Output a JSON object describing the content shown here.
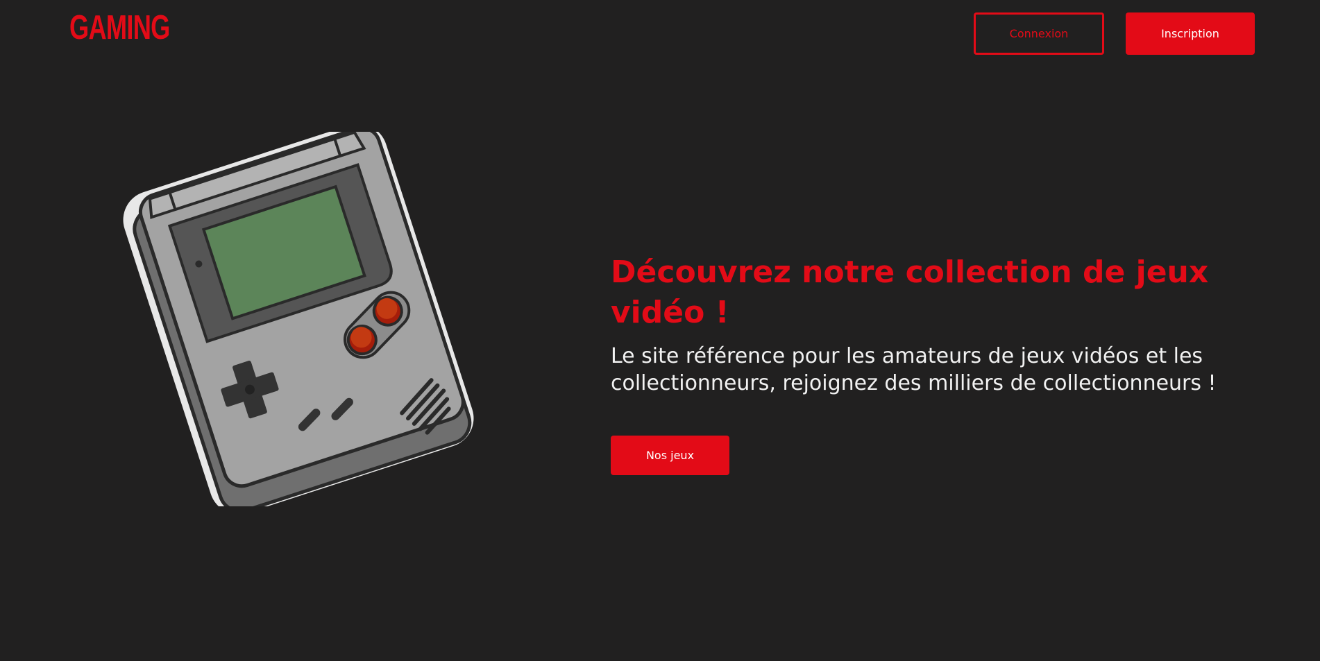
{
  "header": {
    "logo_text": "GAMING",
    "login_label": "Connexion",
    "signup_label": "Inscription"
  },
  "hero": {
    "title": "Découvrez notre collection de jeux vidéo !",
    "subtitle": "Le site référence pour les amateurs de jeux vidéos et les collectionneurs, rejoignez des milliers de collectionneurs !",
    "cta_label": "Nos jeux",
    "illustration": "handheld-console-icon"
  },
  "colors": {
    "background": "#212020",
    "accent": "#e30b17",
    "text": "#f2f2f2"
  }
}
